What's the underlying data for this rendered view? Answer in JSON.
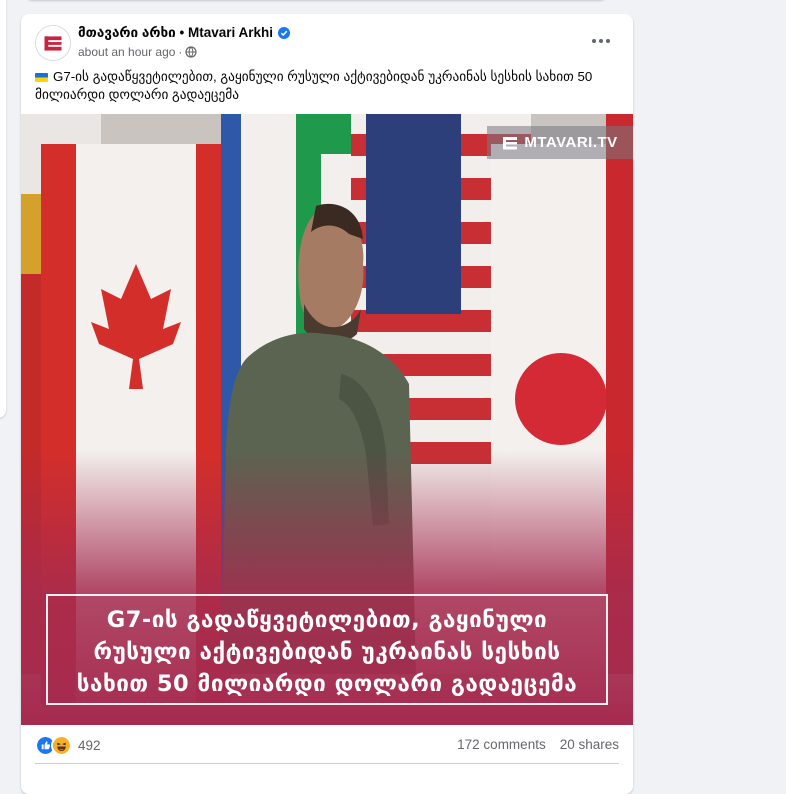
{
  "post": {
    "page_name": "მთავარი არხი • Mtavari Arkhi",
    "timestamp": "about an hour ago",
    "separator": "·",
    "verified_icon": "verified-badge-icon",
    "privacy_icon": "globe-icon",
    "more_icon": "more-options-icon",
    "flag": "ukraine-flag-emoji",
    "text": "G7-ის გადაწყვეტილებით, გაყინული რუსული აქტივებიდან უკრაინას სესხის სახით 50 მილიარდი დოლარი გადაეცემა"
  },
  "media": {
    "watermark": "MTAVARI.TV",
    "banner_lines": [
      "G7-ის გადაწყვეტილებით, გაყინული",
      "რუსული აქტივებიდან უკრაინას სესხის",
      "სახით 50 მილიარდი დოლარი გადაეცემა"
    ]
  },
  "engagement": {
    "reactions": [
      "like-icon",
      "haha-icon"
    ],
    "reaction_count": "492",
    "comments": "172 comments",
    "shares": "20 shares"
  },
  "colors": {
    "accent": "#1877f2",
    "banner_gradient": "#a52b4f",
    "text_secondary": "#65676b"
  }
}
